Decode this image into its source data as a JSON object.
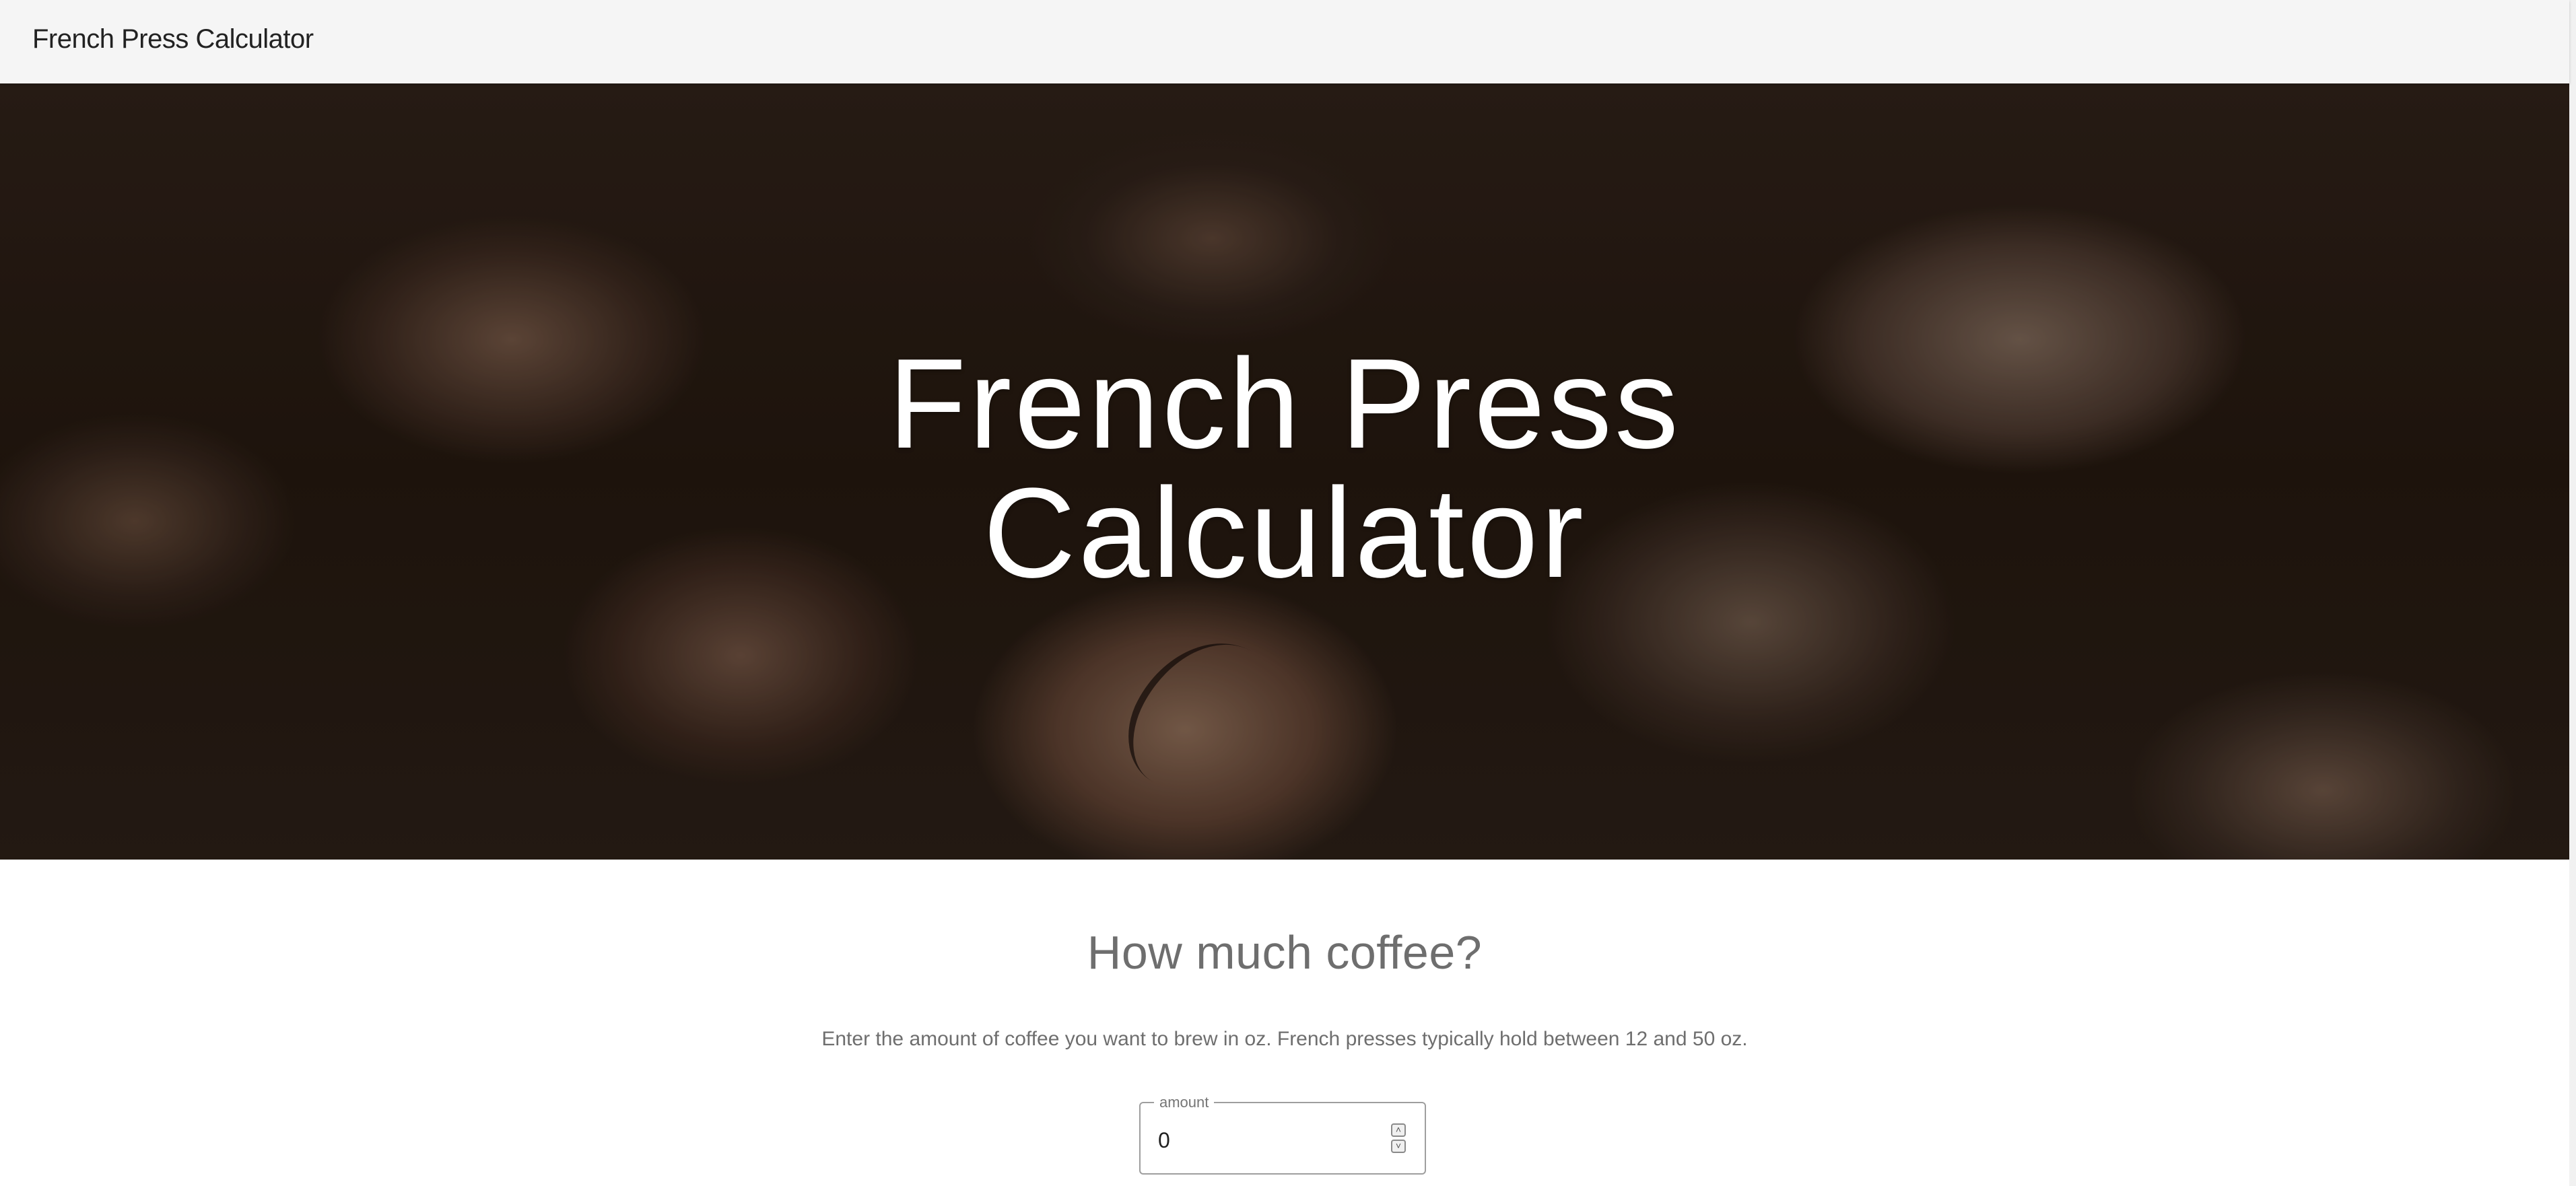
{
  "navbar": {
    "title": "French Press Calculator"
  },
  "hero": {
    "title_line1": "French Press",
    "title_line2": "Calculator"
  },
  "calculator": {
    "heading": "How much coffee?",
    "description": "Enter the amount of coffee you want to brew in oz. French presses typically hold between 12 and 50 oz.",
    "amount_field": {
      "label": "amount",
      "value": "0"
    }
  },
  "icons": {
    "spinner_up": "chevron-up-icon",
    "spinner_down": "chevron-down-icon"
  },
  "colors": {
    "navbar_bg": "#f5f5f5",
    "hero_text": "#ffffff",
    "body_text": "#6e6e6e"
  }
}
